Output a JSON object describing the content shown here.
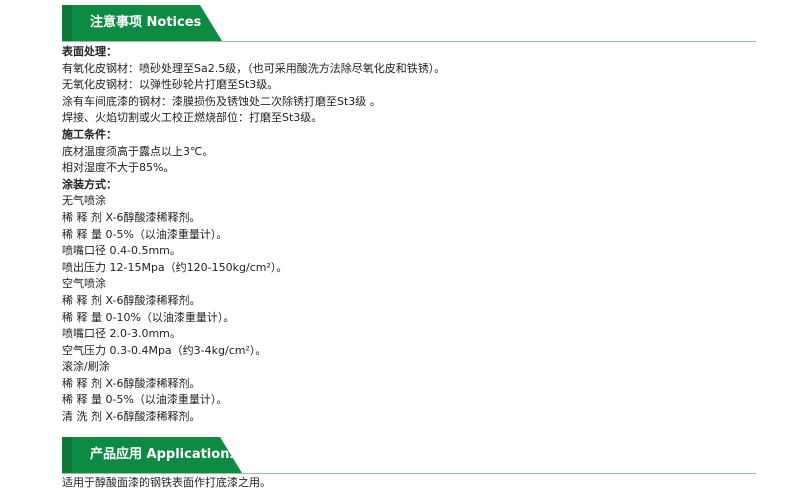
{
  "notices": {
    "title": "注意事项 Notices",
    "lines": [
      {
        "text": "表面处理：",
        "bold": true
      },
      {
        "text": "有氧化皮钢材：喷砂处理至Sa2.5级，（也可采用酸洗方法除尽氧化皮和铁锈）。",
        "bold": false
      },
      {
        "text": "无氧化皮钢材：以弹性砂轮片打磨至St3级。",
        "bold": false
      },
      {
        "text": "涂有车间底漆的钢材：漆膜损伤及锈蚀处二次除锈打磨至St3级 。",
        "bold": false
      },
      {
        "text": "焊接、火焰切割或火工校正燃烧部位：打磨至St3级。",
        "bold": false
      },
      {
        "text": "施工条件：",
        "bold": true
      },
      {
        "text": "底材温度须高于露点以上3℃。",
        "bold": false
      },
      {
        "text": "相对湿度不大于85%。",
        "bold": false
      },
      {
        "text": "涂装方式：",
        "bold": true
      },
      {
        "text": "无气喷涂",
        "bold": false
      },
      {
        "text": "稀 释 剂    X-6醇酸漆稀释剂。",
        "bold": false
      },
      {
        "text": "稀 释 量    0-5%（以油漆重量计）。",
        "bold": false
      },
      {
        "text": "喷嘴口径    0.4-0.5mm。",
        "bold": false
      },
      {
        "text": "喷出压力    12-15Mpa（约120-150kg/cm²）。",
        "bold": false
      },
      {
        "text": "空气喷涂",
        "bold": false
      },
      {
        "text": "稀 释 剂    X-6醇酸漆稀释剂。",
        "bold": false
      },
      {
        "text": "稀 释 量    0-10%（以油漆重量计）。",
        "bold": false
      },
      {
        "text": "喷嘴口径    2.0-3.0mm。",
        "bold": false
      },
      {
        "text": "空气压力    0.3-0.4Mpa（约3-4kg/cm²）。",
        "bold": false
      },
      {
        "text": "滚涂/刷涂",
        "bold": false
      },
      {
        "text": "稀 释 剂    X-6醇酸漆稀释剂。",
        "bold": false
      },
      {
        "text": "稀 释 量    0-5%（以油漆重量计）。",
        "bold": false
      },
      {
        "text": "清 洗 剂    X-6醇酸漆稀释剂。",
        "bold": false
      }
    ]
  },
  "applications": {
    "title": "产品应用 Applications",
    "text": "适用于醇酸面漆的钢铁表面作打底漆之用。"
  },
  "colors": {
    "header_green": "#0d8b43",
    "accent_green": "#0d7a3c",
    "rule_green": "#8cc9a2"
  }
}
